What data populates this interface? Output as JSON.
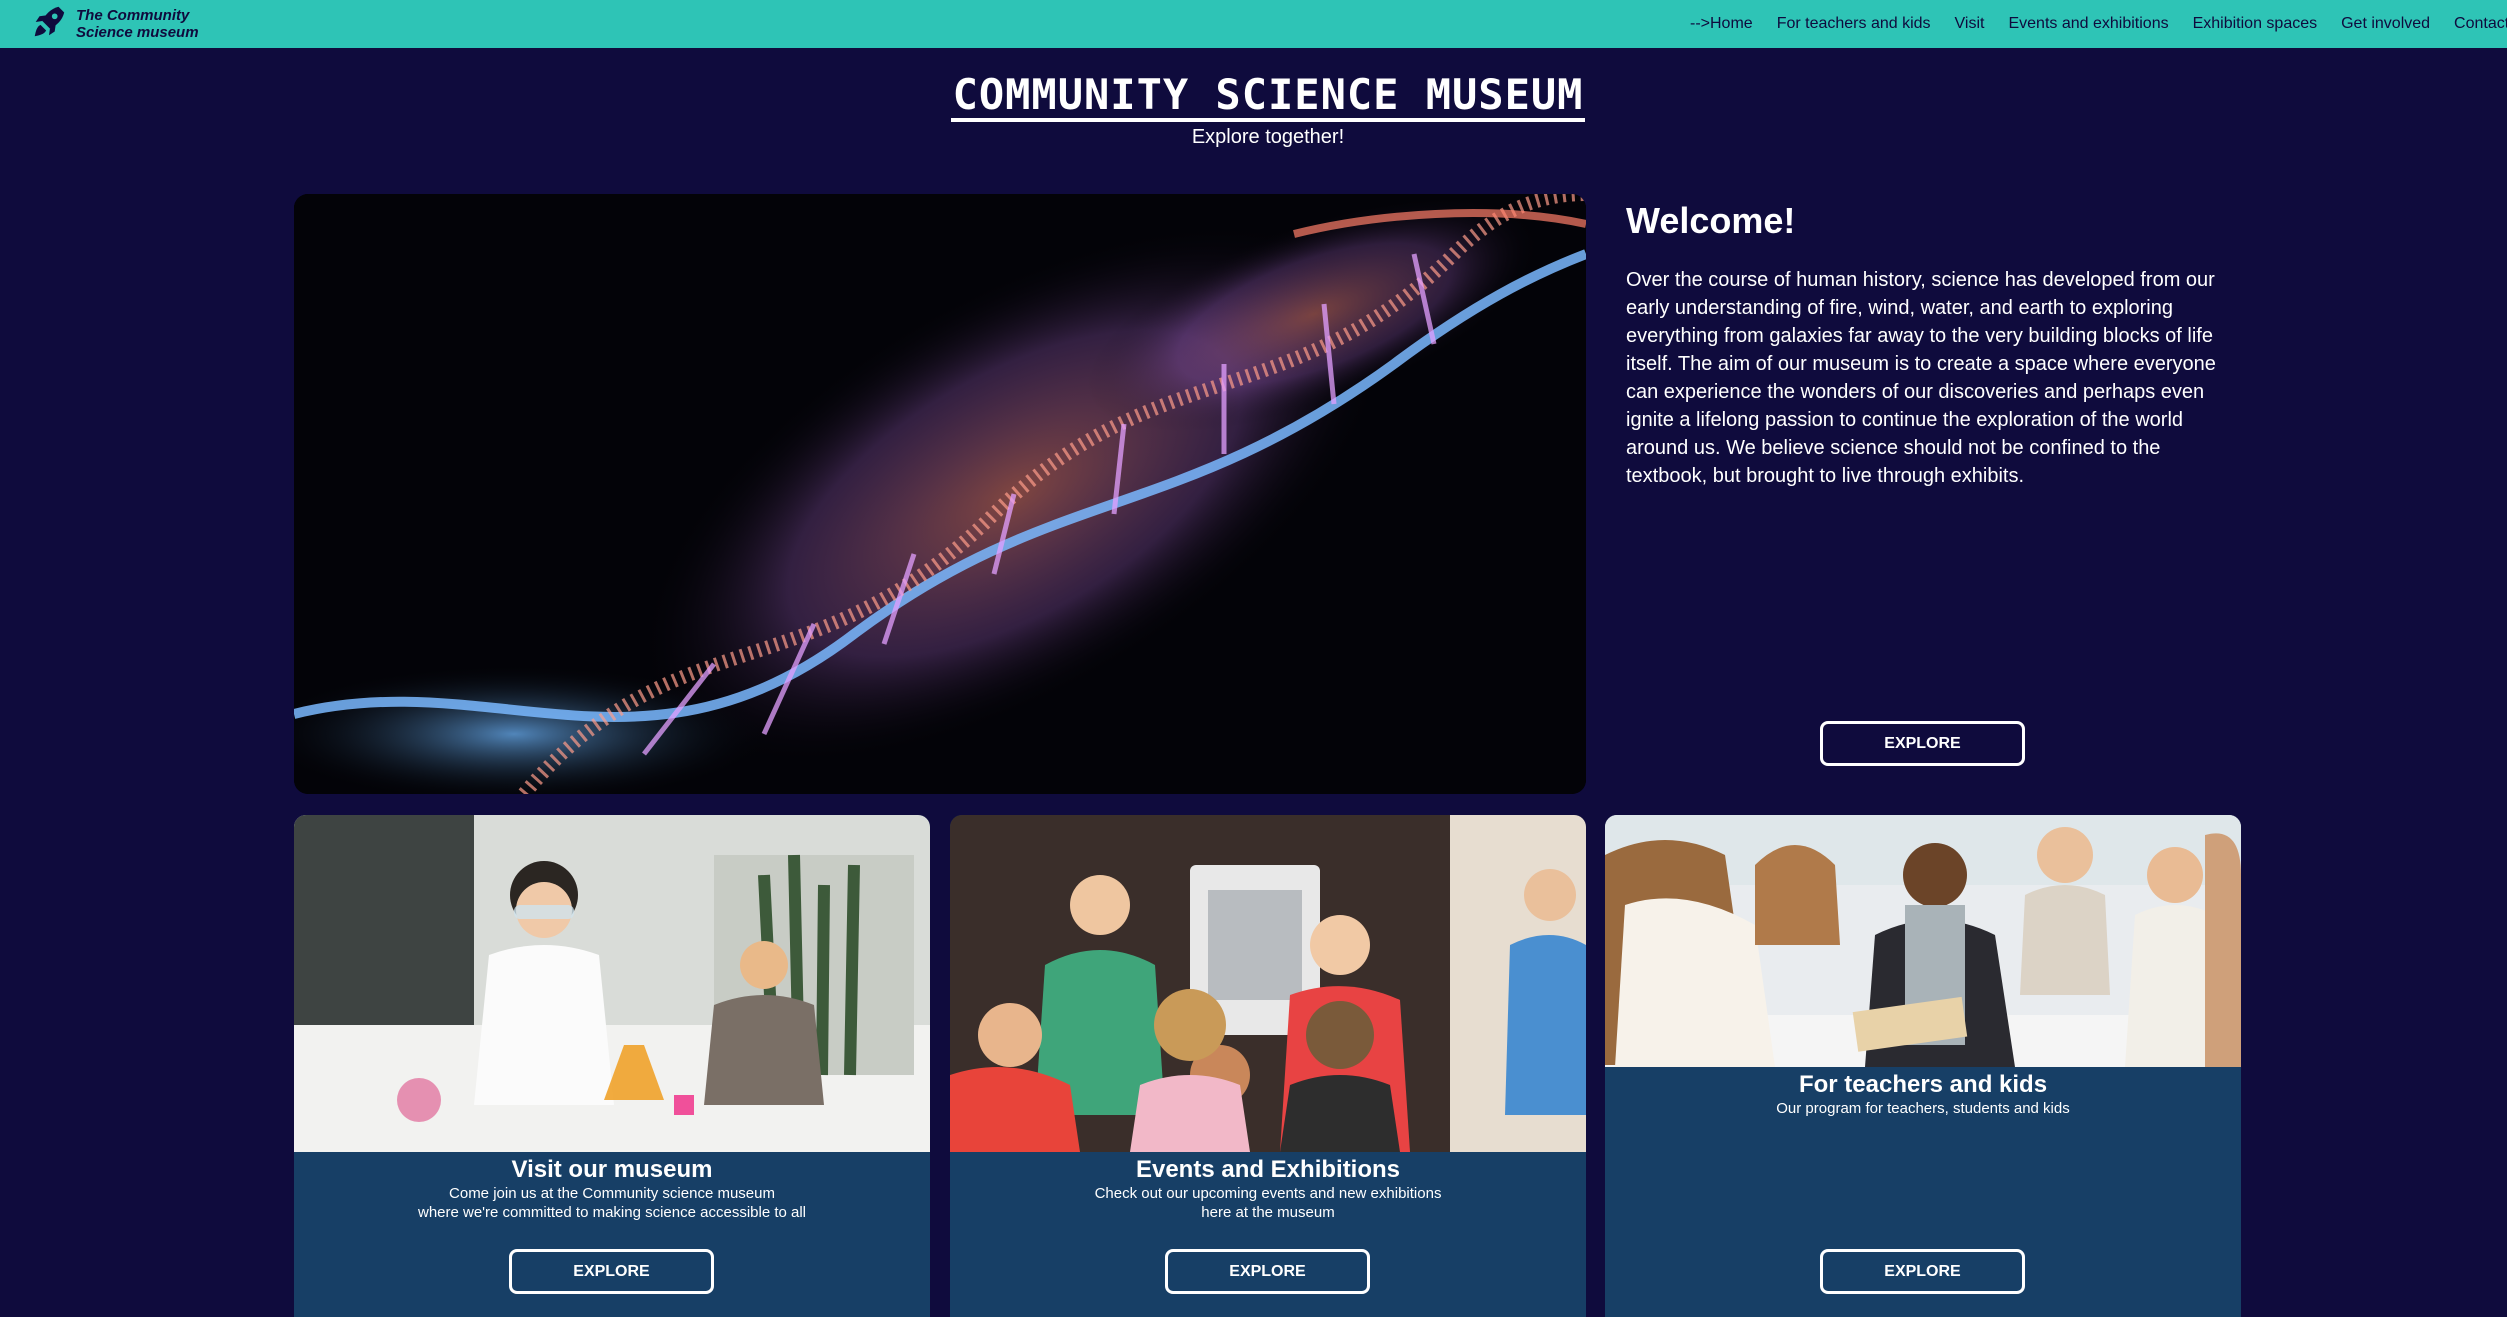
{
  "nav": {
    "brand": "The Community Science museum",
    "links": [
      "-->Home",
      "For teachers and kids",
      "Visit",
      "Events and exhibitions",
      "Exhibition spaces",
      "Get involved",
      "Contact"
    ]
  },
  "header": {
    "title": "Community Science Museum",
    "tagline": "Explore together!"
  },
  "welcome": {
    "heading": "Welcome!",
    "body": "Over the course of human history, science has developed from our early understanding of fire, wind, water, and earth to exploring everything from galaxies far away to the very building blocks of life itself. The aim of our museum is to create a space where everyone can experience the wonders of our discoveries and perhaps even ignite a lifelong passion to continue the exploration of the world around us. We believe science should not be confined to the textbook, but brought to live through exhibits.",
    "button": "EXPLORE"
  },
  "cards": [
    {
      "title": "Visit our museum",
      "description": "Come join us at the Community science museum\nwhere we're committed to making science accessible to all",
      "button": "EXPLORE"
    },
    {
      "title": "Events and Exhibitions",
      "description": "Check out our upcoming events and new exhibitions\nhere at the museum",
      "button": "EXPLORE"
    },
    {
      "title": "For teachers and kids",
      "description": "Our program for teachers, students and kids",
      "button": "EXPLORE"
    }
  ],
  "icons": {
    "brand": "rocket-icon"
  },
  "colors": {
    "nav_bg": "#2ec4b6",
    "page_bg": "#0f0b3d",
    "card_bg": "#173f66"
  }
}
